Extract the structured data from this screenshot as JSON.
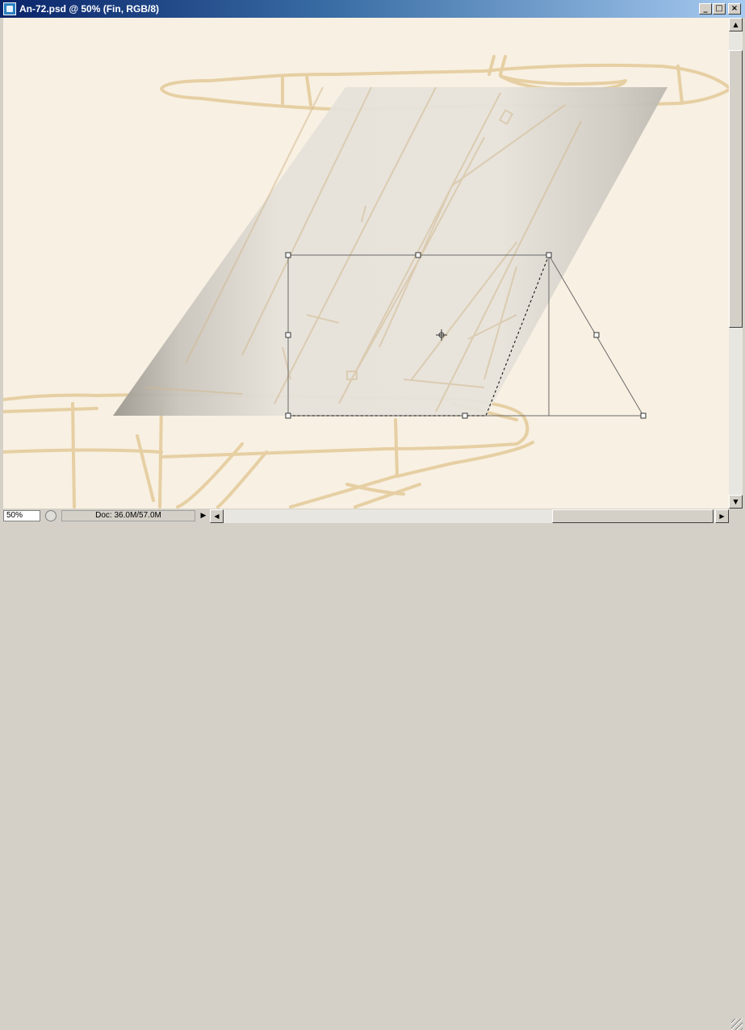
{
  "window": {
    "title": "An-72.psd @ 50% (Fin, RGB/8)",
    "controls": {
      "minimize": "_",
      "maximize": "□",
      "close": "×"
    }
  },
  "status": {
    "zoom": "50%",
    "doc_info": "Doc: 36.0M/57.0M",
    "menu_arrow": "▶"
  },
  "scroll": {
    "up": "▲",
    "down": "▼",
    "left": "◀",
    "right": "▶"
  },
  "colors": {
    "canvas_bg": "#f8f0e2",
    "sketch": "#e3c99a",
    "fin_light": "#e9e5dd",
    "fin_dark": "#a8a49c",
    "transform": "#555555"
  }
}
